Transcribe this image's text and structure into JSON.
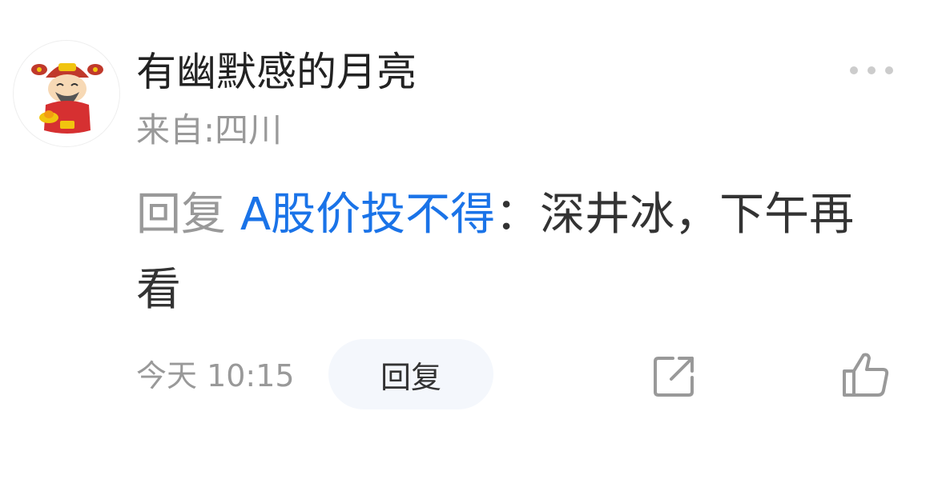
{
  "comment": {
    "username": "有幽默感的月亮",
    "location": "来自:四川",
    "reply_prefix": "回复",
    "reply_target": "A股价投不得",
    "separator": "：",
    "text": "深井冰，下午再看",
    "time": "今天 10:15",
    "reply_button_label": "回复"
  },
  "icons": {
    "avatar": "avatar-caishen-icon",
    "more": "more-dots-icon",
    "share": "share-icon",
    "like": "thumbs-up-icon"
  },
  "colors": {
    "username": "#222222",
    "secondary_text": "#999999",
    "link": "#1a73e8",
    "button_bg": "#f4f7fc",
    "icon": "#999999"
  }
}
